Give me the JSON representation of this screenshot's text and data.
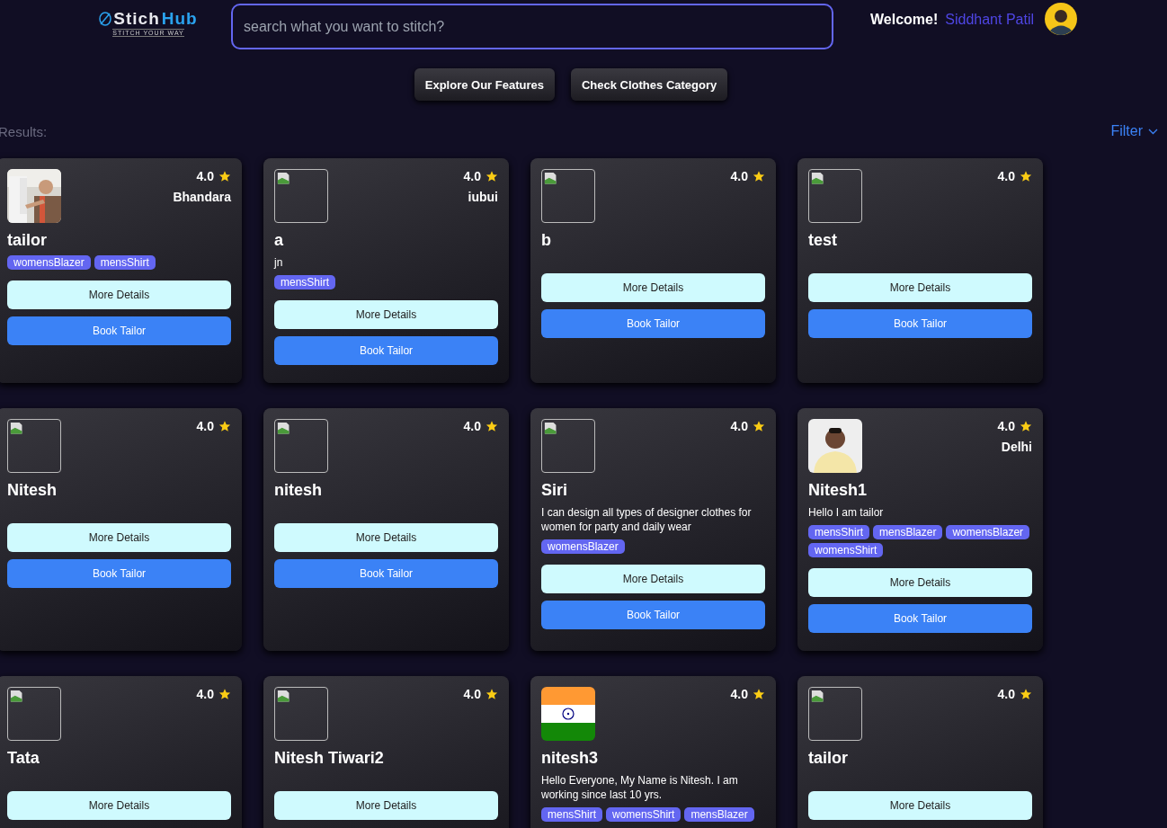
{
  "header": {
    "logo": {
      "word_1": "Stich",
      "word_2": "Hub",
      "tagline": "STITCH YOUR WAY"
    },
    "search": {
      "placeholder": "search what you want to stitch?"
    },
    "welcome": "Welcome!",
    "user_name": "Siddhant Patil"
  },
  "actions": [
    "Explore Our Features",
    "Check Clothes Category"
  ],
  "results_label": "Results:",
  "filter": "Filter",
  "cards": [
    {
      "rating": "4.0",
      "location": "Bhandara",
      "name": "tailor",
      "tags": [
        "womensBlazer",
        "mensShirt"
      ],
      "buttons": [
        "More Details",
        "Book Tailor"
      ]
    },
    {
      "kind": "broken",
      "rating": "4.0",
      "location": "iubui",
      "name": "a",
      "description": "jn",
      "tags": [
        "mensShirt"
      ],
      "buttons": [
        "More Details",
        "Book Tailor"
      ]
    },
    {
      "kind": "broken",
      "rating": "4.0",
      "name": "b",
      "buttons": [
        "More Details",
        "Book Tailor"
      ]
    },
    {
      "kind": "broken",
      "rating": "4.0",
      "name": "test",
      "buttons": [
        "More Details",
        "Book Tailor"
      ]
    },
    {
      "kind": "broken",
      "rating": "4.0",
      "name": "Nitesh",
      "buttons": [
        "More Details",
        "Book Tailor"
      ]
    },
    {
      "kind": "broken",
      "rating": "4.0",
      "name": "nitesh",
      "buttons": [
        "More Details",
        "Book Tailor"
      ]
    },
    {
      "kind": "broken",
      "rating": "4.0",
      "name": "Siri",
      "description": "I can design all types of designer clothes for women for party and daily wear",
      "tags": [
        "womensBlazer"
      ],
      "buttons": [
        "More Details",
        "Book Tailor"
      ]
    },
    {
      "rating": "4.0",
      "location": "Delhi",
      "name": "Nitesh1",
      "description": "Hello I am tailor",
      "tags": [
        "mensShirt",
        "mensBlazer",
        "womensBlazer",
        "womensShirt"
      ],
      "buttons": [
        "More Details",
        "Book Tailor"
      ]
    },
    {
      "kind": "broken",
      "rating": "4.0",
      "name": "Tata",
      "buttons": [
        "More Details"
      ]
    },
    {
      "kind": "broken",
      "rating": "4.0",
      "name": "Nitesh Tiwari2",
      "buttons": [
        "More Details"
      ]
    },
    {
      "kind": "flag",
      "rating": "4.0",
      "name": "nitesh3",
      "description": "Hello Everyone, My Name is Nitesh. I am working since last 10 yrs.",
      "tags": [
        "mensShirt",
        "womensShirt",
        "mensBlazer"
      ]
    },
    {
      "kind": "broken",
      "rating": "4.0",
      "name": "tailor",
      "buttons": [
        "More Details"
      ]
    }
  ]
}
